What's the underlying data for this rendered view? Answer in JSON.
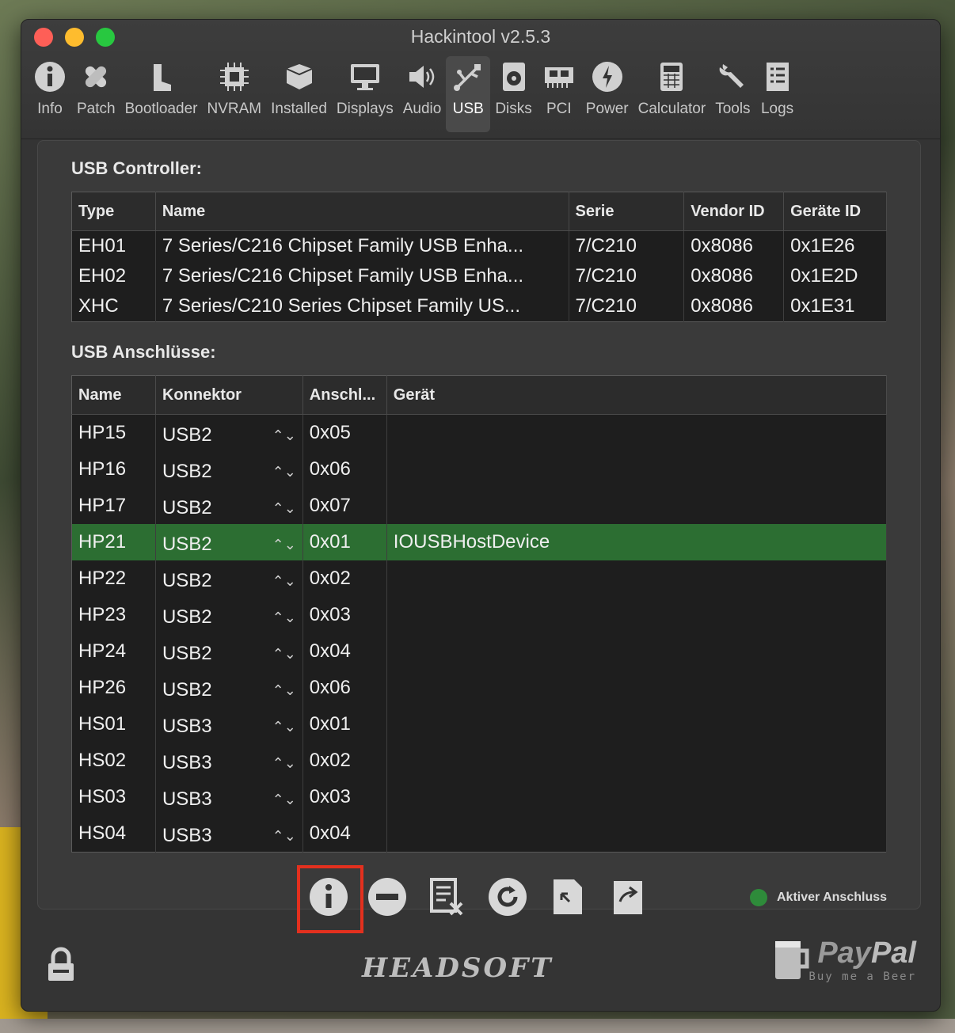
{
  "window": {
    "title": "Hackintool v2.5.3"
  },
  "toolbar": {
    "items": [
      {
        "label": "Info",
        "icon": "info-icon"
      },
      {
        "label": "Patch",
        "icon": "bandage-icon"
      },
      {
        "label": "Bootloader",
        "icon": "boot-icon"
      },
      {
        "label": "NVRAM",
        "icon": "chip-icon"
      },
      {
        "label": "Installed",
        "icon": "box-icon"
      },
      {
        "label": "Displays",
        "icon": "monitor-icon"
      },
      {
        "label": "Audio",
        "icon": "speaker-icon"
      },
      {
        "label": "USB",
        "icon": "usb-icon",
        "active": true
      },
      {
        "label": "Disks",
        "icon": "disk-icon"
      },
      {
        "label": "PCI",
        "icon": "pci-card-icon"
      },
      {
        "label": "Power",
        "icon": "power-icon"
      },
      {
        "label": "Calculator",
        "icon": "calculator-icon"
      },
      {
        "label": "Tools",
        "icon": "wrench-icon"
      },
      {
        "label": "Logs",
        "icon": "logs-icon"
      }
    ]
  },
  "controller": {
    "title": "USB Controller:",
    "headers": [
      "Type",
      "Name",
      "Serie",
      "Vendor ID",
      "Geräte ID"
    ],
    "rows": [
      [
        "EH01",
        "7 Series/C216 Chipset Family USB Enha...",
        "7/C210",
        "0x8086",
        "0x1E26"
      ],
      [
        "EH02",
        "7 Series/C216 Chipset Family USB Enha...",
        "7/C210",
        "0x8086",
        "0x1E2D"
      ],
      [
        "XHC",
        "7 Series/C210 Series Chipset Family US...",
        "7/C210",
        "0x8086",
        "0x1E31"
      ]
    ]
  },
  "ports": {
    "title": "USB Anschlüsse:",
    "headers": [
      "Name",
      "Konnektor",
      "Anschl...",
      "Gerät"
    ],
    "rows": [
      {
        "name": "HP15",
        "connector": "USB2",
        "port": "0x05",
        "device": ""
      },
      {
        "name": "HP16",
        "connector": "USB2",
        "port": "0x06",
        "device": ""
      },
      {
        "name": "HP17",
        "connector": "USB2",
        "port": "0x07",
        "device": ""
      },
      {
        "name": "HP21",
        "connector": "USB2",
        "port": "0x01",
        "device": "IOUSBHostDevice",
        "selected": true
      },
      {
        "name": "HP22",
        "connector": "USB2",
        "port": "0x02",
        "device": ""
      },
      {
        "name": "HP23",
        "connector": "USB2",
        "port": "0x03",
        "device": ""
      },
      {
        "name": "HP24",
        "connector": "USB2",
        "port": "0x04",
        "device": ""
      },
      {
        "name": "HP26",
        "connector": "USB2",
        "port": "0x06",
        "device": ""
      },
      {
        "name": "HS01",
        "connector": "USB3",
        "port": "0x01",
        "device": ""
      },
      {
        "name": "HS02",
        "connector": "USB3",
        "port": "0x02",
        "device": ""
      },
      {
        "name": "HS03",
        "connector": "USB3",
        "port": "0x03",
        "device": ""
      },
      {
        "name": "HS04",
        "connector": "USB3",
        "port": "0x04",
        "device": ""
      }
    ]
  },
  "actions": {
    "buttons": [
      "info-icon",
      "remove-icon",
      "clear-list-icon",
      "refresh-icon",
      "import-icon",
      "export-icon"
    ]
  },
  "legend": {
    "label": "Aktiver Anschluss",
    "color": "#2e8b3a"
  },
  "footer": {
    "brand": "HEADSOFT",
    "paypal_pay": "Pay",
    "paypal_pal": "Pal",
    "beer": "Buy me a Beer"
  },
  "colors": {
    "selected_row": "#2c6e32",
    "highlight": "#e3301e"
  }
}
